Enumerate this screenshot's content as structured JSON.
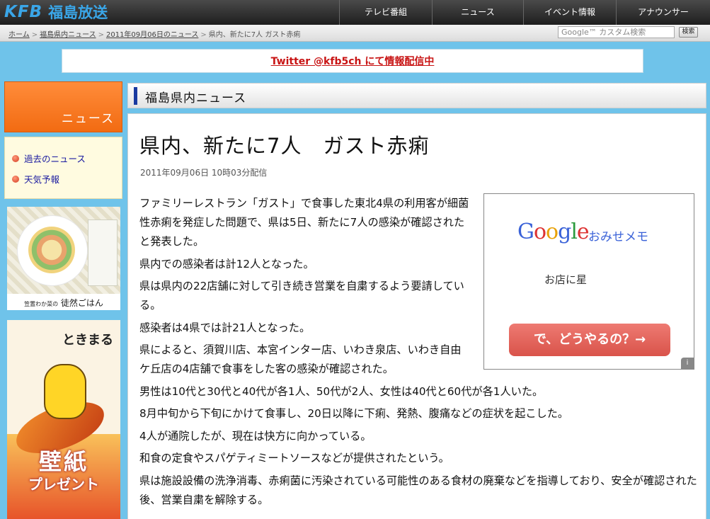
{
  "site": {
    "logo_mark": "KFB",
    "logo_name": "福島放送"
  },
  "nav": [
    "テレビ番組",
    "ニュース",
    "イベント情報",
    "アナウンサー"
  ],
  "breadcrumb": {
    "links": [
      "ホーム",
      "福島県内ニュース",
      "2011年09月06日のニュース"
    ],
    "current": "県内、新たに7人 ガスト赤痢"
  },
  "search": {
    "placeholder": "Google™ カスタム検索",
    "button": "検索"
  },
  "twitter_banner": "Twitter @kfb5ch にて情報配信中",
  "sidebar": {
    "heading": "ニュース",
    "links": [
      "過去のニュース",
      "天気予報"
    ],
    "ad1": {
      "caption_small": "笠置わか菜の",
      "caption": "徒然ごはん"
    },
    "ad2": {
      "brand": "ときまる",
      "title": "壁紙",
      "subtitle": "プレゼント"
    }
  },
  "section": {
    "title": "福島県内ニュース"
  },
  "article": {
    "headline": "県内、新たに7人　ガスト赤痢",
    "dateline": "2011年09月06日 10時03分配信",
    "paragraphs": [
      "ファミリーレストラン「ガスト」で食事した東北4県の利用客が細菌性赤痢を発症した問題で、県は5日、新たに7人の感染が確認されたと発表した。",
      "県内での感染者は計12人となった。",
      "県は県内の22店舗に対して引き続き営業を自粛するよう要請している。",
      "感染者は4県では計21人となった。",
      "県によると、須賀川店、本宮インター店、いわき泉店、いわき自由ケ丘店の4店舗で食事をした客の感染が確認された。"
    ],
    "paragraphs_wide": [
      "男性は10代と30代と40代が各1人、50代が2人、女性は40代と60代が各1人いた。",
      "8月中旬から下旬にかけて食事し、20日以降に下痢、発熱、腹痛などの症状を起こした。",
      "4人が通院したが、現在は快方に向かっている。",
      "和食の定食やスパゲティミートソースなどが提供されたという。",
      "県は施設設備の洗浄消毒、赤痢菌に汚染されている可能性のある食材の廃棄などを指導しており、安全が確認された後、営業自粛を解除する。"
    ]
  },
  "google_ad": {
    "logo": [
      "G",
      "o",
      "o",
      "g",
      "l",
      "e"
    ],
    "product": "おみせメモ",
    "line": "お店に星",
    "cta": "で、どうやるの？→",
    "info": "i"
  }
}
